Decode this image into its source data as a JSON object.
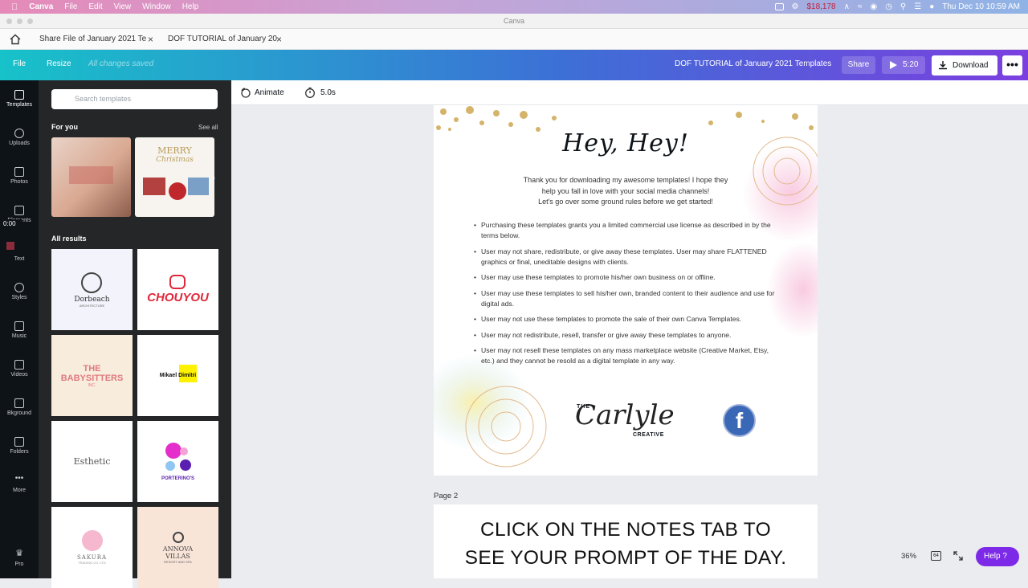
{
  "macos_menubar": {
    "app": "Canva",
    "menus": [
      "File",
      "Edit",
      "View",
      "Window",
      "Help"
    ],
    "status_amount": "$18,178",
    "datetime": "Thu Dec 10  10:59 AM"
  },
  "window_title": "Canva",
  "browser_tabs": [
    {
      "label": "Share File of January 2021 Te"
    },
    {
      "label": "DOF TUTORIAL of January 20"
    }
  ],
  "topbar": {
    "file": "File",
    "resize": "Resize",
    "saved_status": "All changes saved",
    "doc_title": "DOF TUTORIAL of January 2021 Templates",
    "share": "Share",
    "play_time": "5:20",
    "download": "Download",
    "more": "•••"
  },
  "rail": [
    {
      "label": "Templates",
      "icon": "templates-icon"
    },
    {
      "label": "Uploads",
      "icon": "upload-icon"
    },
    {
      "label": "Photos",
      "icon": "photo-icon"
    },
    {
      "label": "Elements",
      "icon": "elements-icon"
    },
    {
      "label": "Text",
      "icon": "text-icon"
    },
    {
      "label": "Styles",
      "icon": "palette-icon"
    },
    {
      "label": "Music",
      "icon": "music-icon"
    },
    {
      "label": "Videos",
      "icon": "video-icon"
    },
    {
      "label": "Bkground",
      "icon": "background-icon"
    },
    {
      "label": "Folders",
      "icon": "folder-icon"
    },
    {
      "label": "More",
      "icon": "more-icon"
    },
    {
      "label": "Pro",
      "icon": "crown-icon"
    }
  ],
  "recording_timer": "0:00",
  "panel": {
    "search_placeholder": "Search templates",
    "for_you": "For you",
    "see_all": "See all",
    "foryou_merry": "MERRY",
    "foryou_christmas": "Christmas",
    "all_results": "All results",
    "results": [
      {
        "name": "Dorbeach",
        "sub": "ARCHITECTURE"
      },
      {
        "name": "CHOUYOU"
      },
      {
        "name": "THE BABYSITTERS",
        "sub": "INC."
      },
      {
        "name": "Mikael Dimitri"
      },
      {
        "name": "Esthetic"
      },
      {
        "name": "PORTERINO'S"
      },
      {
        "name": "SAKURA",
        "sub": "TRADING CO. LTD"
      },
      {
        "name": "ANNOVA VILLAS",
        "sub": "RESORT AND SPA"
      }
    ]
  },
  "toolbar": {
    "animate": "Animate",
    "duration": "5.0s"
  },
  "page1": {
    "heading": "Hey, Hey!",
    "intro": [
      "Thank you for downloading my awesome templates! I hope they",
      "help you fall in love with your social media channels!",
      "Let's go over some ground rules before we get started!"
    ],
    "rules": [
      "Purchasing these templates grants you a limited commercial use license as described in by the terms below.",
      "User may not share, redistribute, or give away these templates. User may share FLATTENED graphics or final, uneditable designs with clients.",
      "User may use these templates to promote his/her own business on or offline.",
      "User may use these templates to sell his/her own, branded content to their audience and use for digital ads.",
      "User may not use these templates to promote the sale of their own Canva Templates.",
      "User may not redistribute, resell, transfer or give away these templates to anyone.",
      "User may not resell these templates on any mass marketplace website (Creative Market, Etsy, etc.) and they cannot be resold as a digital template in any way."
    ],
    "logo_the": "THE",
    "logo_script": "Carlyle",
    "logo_creative": "CREATIVE",
    "fb": "f"
  },
  "page2": {
    "label": "Page 2",
    "line1": "CLICK ON THE NOTES TAB TO",
    "line2": "SEE YOUR PROMPT OF THE DAY."
  },
  "footer": {
    "zoom": "36%",
    "pages": "64",
    "help": "Help ?"
  },
  "colors": {
    "accent_purple": "#7d2ae8",
    "topbar_start": "#17c2c9",
    "topbar_end": "#7b3fe0",
    "rail_bg": "#0e1318",
    "panel_bg": "#252627"
  }
}
